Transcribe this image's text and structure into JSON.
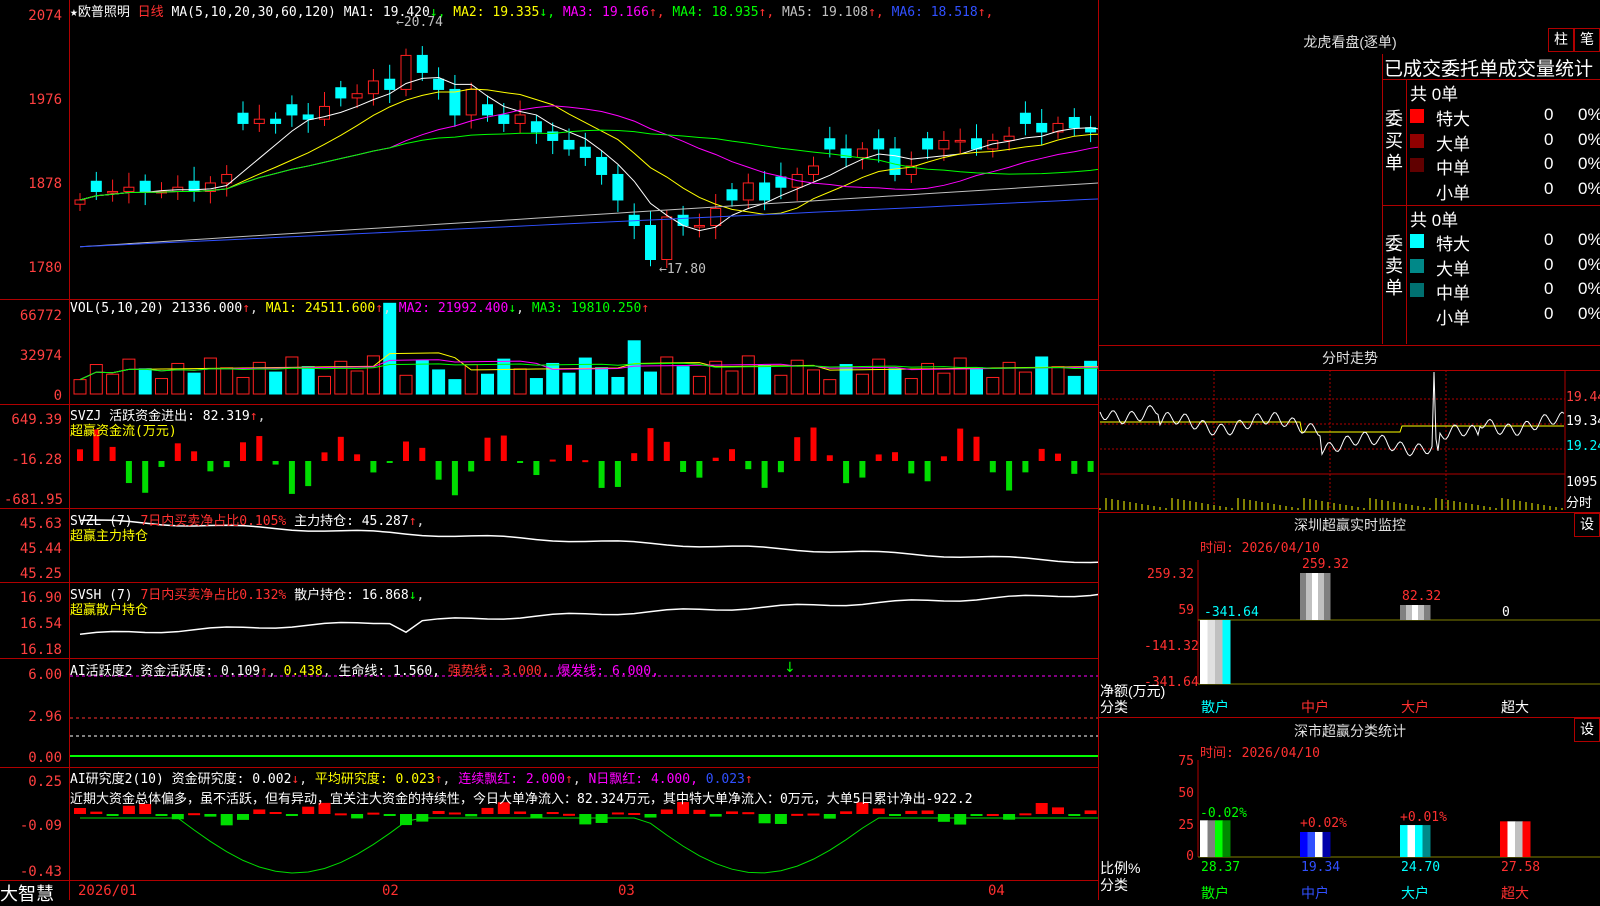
{
  "stock": {
    "name": "★欧普照明",
    "period": "日线",
    "ma_header": "MA(5,10,20,30,60,120)",
    "ma": [
      {
        "label": "MA1: 19.420",
        "arrow": "↓",
        "color": "#ffffff"
      },
      {
        "label": "MA2: 19.335",
        "arrow": "↓",
        "color": "#ffff00"
      },
      {
        "label": "MA3: 19.166",
        "arrow": "↑",
        "color": "#ff00ff"
      },
      {
        "label": "MA4: 18.935",
        "arrow": "↑",
        "color": "#00ff00"
      },
      {
        "label": "MA5: 19.108",
        "arrow": "↑",
        "color": "#c0c0c0"
      },
      {
        "label": "MA6: 18.518",
        "arrow": "↑",
        "color": "#3050ff"
      }
    ],
    "price_axis": [
      "2074",
      "1976",
      "1878",
      "1780"
    ],
    "high_mark": "20.74",
    "low_mark": "17.80"
  },
  "volume": {
    "header": "VOL(5,10,20)",
    "value": "21336.000",
    "ma1": "MA1: 24511.600",
    "ma2": "MA2: 21992.400",
    "ma3": "MA3: 19810.250",
    "axis": [
      "66772",
      "32974",
      "0"
    ]
  },
  "svzj": {
    "header": "SVZJ  活跃资金进出: 82.319",
    "sub": "超赢资金流(万元)",
    "axis": [
      "649.39",
      "-16.28",
      "-681.95"
    ]
  },
  "svzl": {
    "header": "SVZL (7)",
    "desc": "7日内买卖净占比0.105%",
    "value": "主力持仓: 45.287",
    "sub": "超赢主力持仓",
    "axis": [
      "45.63",
      "45.44",
      "45.25"
    ]
  },
  "svsh": {
    "header": "SVSH (7)",
    "desc": "7日内买卖净占比0.132%",
    "value": "散户持仓: 16.868",
    "sub": "超赢散户持仓",
    "axis": [
      "16.90",
      "16.54",
      "16.18"
    ]
  },
  "ai_active": {
    "header": "AI活跃度2",
    "text": "资金活跃度: 0.109",
    "v2": "0.438",
    "life": "生命线: 1.560,",
    "strong": "强势线: 3.000,",
    "burst": "爆发线: 6.000,",
    "axis": [
      "6.00",
      "2.96",
      "0.00"
    ]
  },
  "ai_research": {
    "header": "AI研究度2(10)",
    "text": "资金研究度: 0.002",
    "avg": "平均研究度: 0.023",
    "red": "连续飘红: 2.000",
    "nred": "N日飘红: 4.000,",
    "v": "0.023",
    "comment": "近期大资金总体偏多，虽不活跃，但有异动，宜关注大资金的持续性，今日大单净流入：82.324万元，其中特大单净流入：0万元，大单5日累计净出-922.2",
    "axis": [
      "0.25",
      "-0.09",
      "-0.43"
    ]
  },
  "dates": [
    "2026/01",
    "02",
    "03",
    "04"
  ],
  "footer_brand": "大智慧",
  "right": {
    "lhb_title": "龙虎看盘(逐单)",
    "btn_zhu": "柱",
    "btn_bi": "笔",
    "stats_header": "已成交委托单成交量统计",
    "buy_label": "委买单",
    "sell_label": "委卖单",
    "buy_total": "共 0单",
    "sell_total": "共 0单",
    "rows": [
      {
        "name": "特大",
        "v": "0",
        "p": "0%"
      },
      {
        "name": "大单",
        "v": "0",
        "p": "0%"
      },
      {
        "name": "中单",
        "v": "0",
        "p": "0%"
      },
      {
        "name": "小单",
        "v": "0",
        "p": "0%"
      }
    ],
    "intraday_title": "分时走势",
    "intraday_axis": [
      "19.44",
      "19.34",
      "19.24",
      "1095",
      "分时"
    ],
    "monitor_title": "深圳超赢实时监控",
    "set_label": "设",
    "monitor_time": "时间: 2026/04/10",
    "monitor_axis": [
      "259.32",
      "59",
      "-141.32",
      "-341.64"
    ],
    "monitor_values": [
      "-341.64",
      "259.32",
      "82.32",
      "0"
    ],
    "monitor_ylabel": "净额(万元)",
    "monitor_xlabel": "分类",
    "categories": [
      "散户",
      "中户",
      "大户",
      "超大"
    ],
    "class_title": "深市超赢分类统计",
    "class_time": "时间: 2026/04/10",
    "class_axis": [
      "75",
      "50",
      "25",
      "0"
    ],
    "class_changes": [
      "-0.02%",
      "+0.02%",
      "+0.01%"
    ],
    "class_values": [
      "28.37",
      "19.34",
      "24.70",
      "27.58"
    ],
    "class_ylabel": "比例%",
    "class_xlabel": "分类"
  },
  "chart_data": {
    "type": "candlestick",
    "note_colors": {
      "up": "#ff2020",
      "down": "#00ffff"
    },
    "candles_close_trend": [
      18.6,
      18.7,
      18.7,
      18.75,
      18.7,
      18.7,
      18.75,
      18.7,
      18.8,
      18.9,
      19.5,
      19.55,
      19.5,
      19.6,
      19.55,
      19.7,
      19.8,
      19.85,
      20.0,
      19.9,
      20.3,
      20.1,
      19.9,
      19.6,
      19.9,
      19.6,
      19.5,
      19.6,
      19.4,
      19.3,
      19.2,
      19.1,
      18.9,
      18.6,
      18.3,
      17.9,
      18.4,
      18.3,
      18.3,
      18.5,
      18.6,
      18.8,
      18.6,
      18.75,
      18.9,
      19.0,
      19.2,
      19.1,
      19.2,
      19.2,
      18.9,
      19.0,
      19.2,
      19.3,
      19.3,
      19.2,
      19.3,
      19.35,
      19.5,
      19.4,
      19.5,
      19.45,
      19.4,
      19.35
    ]
  }
}
